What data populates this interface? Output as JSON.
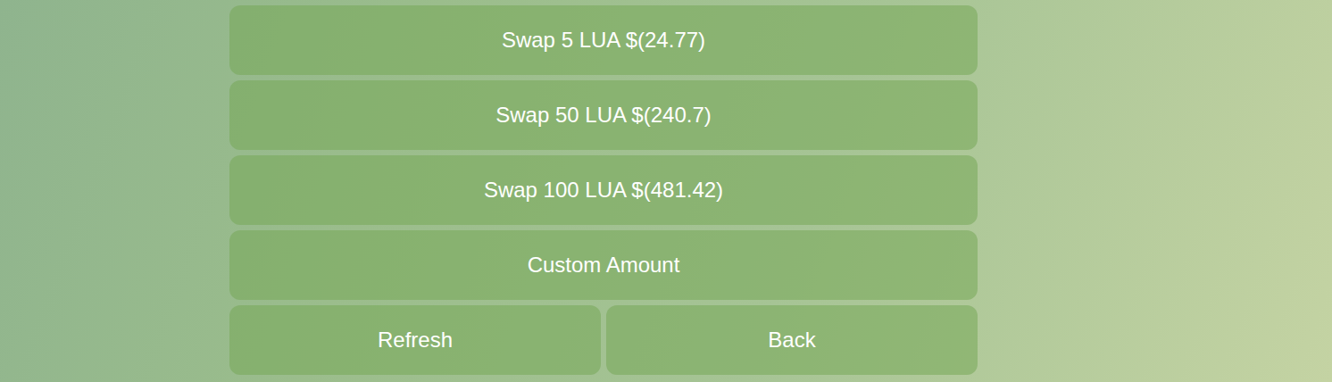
{
  "keyboard": {
    "rows": [
      [
        {
          "label": "Swap 5 LUA $(24.77)"
        }
      ],
      [
        {
          "label": "Swap 50 LUA $(240.7)"
        }
      ],
      [
        {
          "label": "Swap 100 LUA $(481.42)"
        }
      ],
      [
        {
          "label": "Custom Amount"
        }
      ],
      [
        {
          "label": "Refresh"
        },
        {
          "label": "Back"
        }
      ]
    ]
  }
}
